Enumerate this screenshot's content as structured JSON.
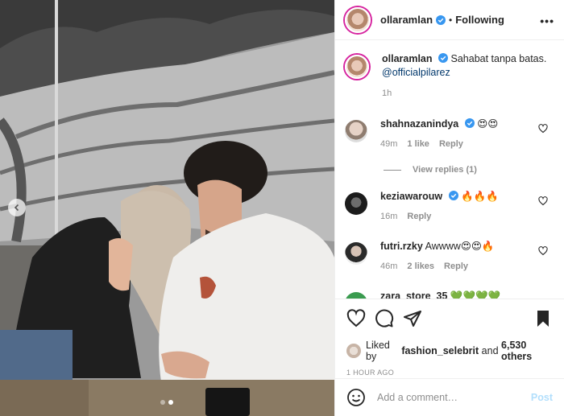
{
  "post": {
    "author": "ollaramlan",
    "follow_state": "Following",
    "more_glyph": "•••",
    "separator": "•"
  },
  "caption": {
    "username": "ollaramlan",
    "text": "Sahabat tanpa batas.",
    "mention": "@officialpilarez",
    "time": "1h"
  },
  "comments": [
    {
      "username": "shahnazanindya",
      "text": "😍😍",
      "time": "49m",
      "likes": "1 like",
      "reply": "Reply",
      "view_replies": "View replies (1)"
    },
    {
      "username": "keziawarouw",
      "text": "🔥🔥🔥",
      "time": "16m",
      "reply": "Reply"
    },
    {
      "username": "futri.rzky",
      "text": "Awwww😍😍🔥",
      "time": "46m",
      "likes": "2 likes",
      "reply": "Reply"
    },
    {
      "username": "zara_store_35",
      "text": "💚💚💚💚"
    }
  ],
  "liked_by": {
    "prefix": "Liked by",
    "user": "fashion_selebrit",
    "middle": "and",
    "count": "6,530 others"
  },
  "timestamp": "1 HOUR AGO",
  "add_comment": {
    "placeholder": "Add a comment…",
    "post_label": "Post"
  },
  "colors": {
    "verified": "#3897f0",
    "link": "#00376b",
    "post_disabled": "#b2dffc",
    "muted": "#8e8e8e"
  },
  "carousel": {
    "current": 2,
    "total": 2
  }
}
